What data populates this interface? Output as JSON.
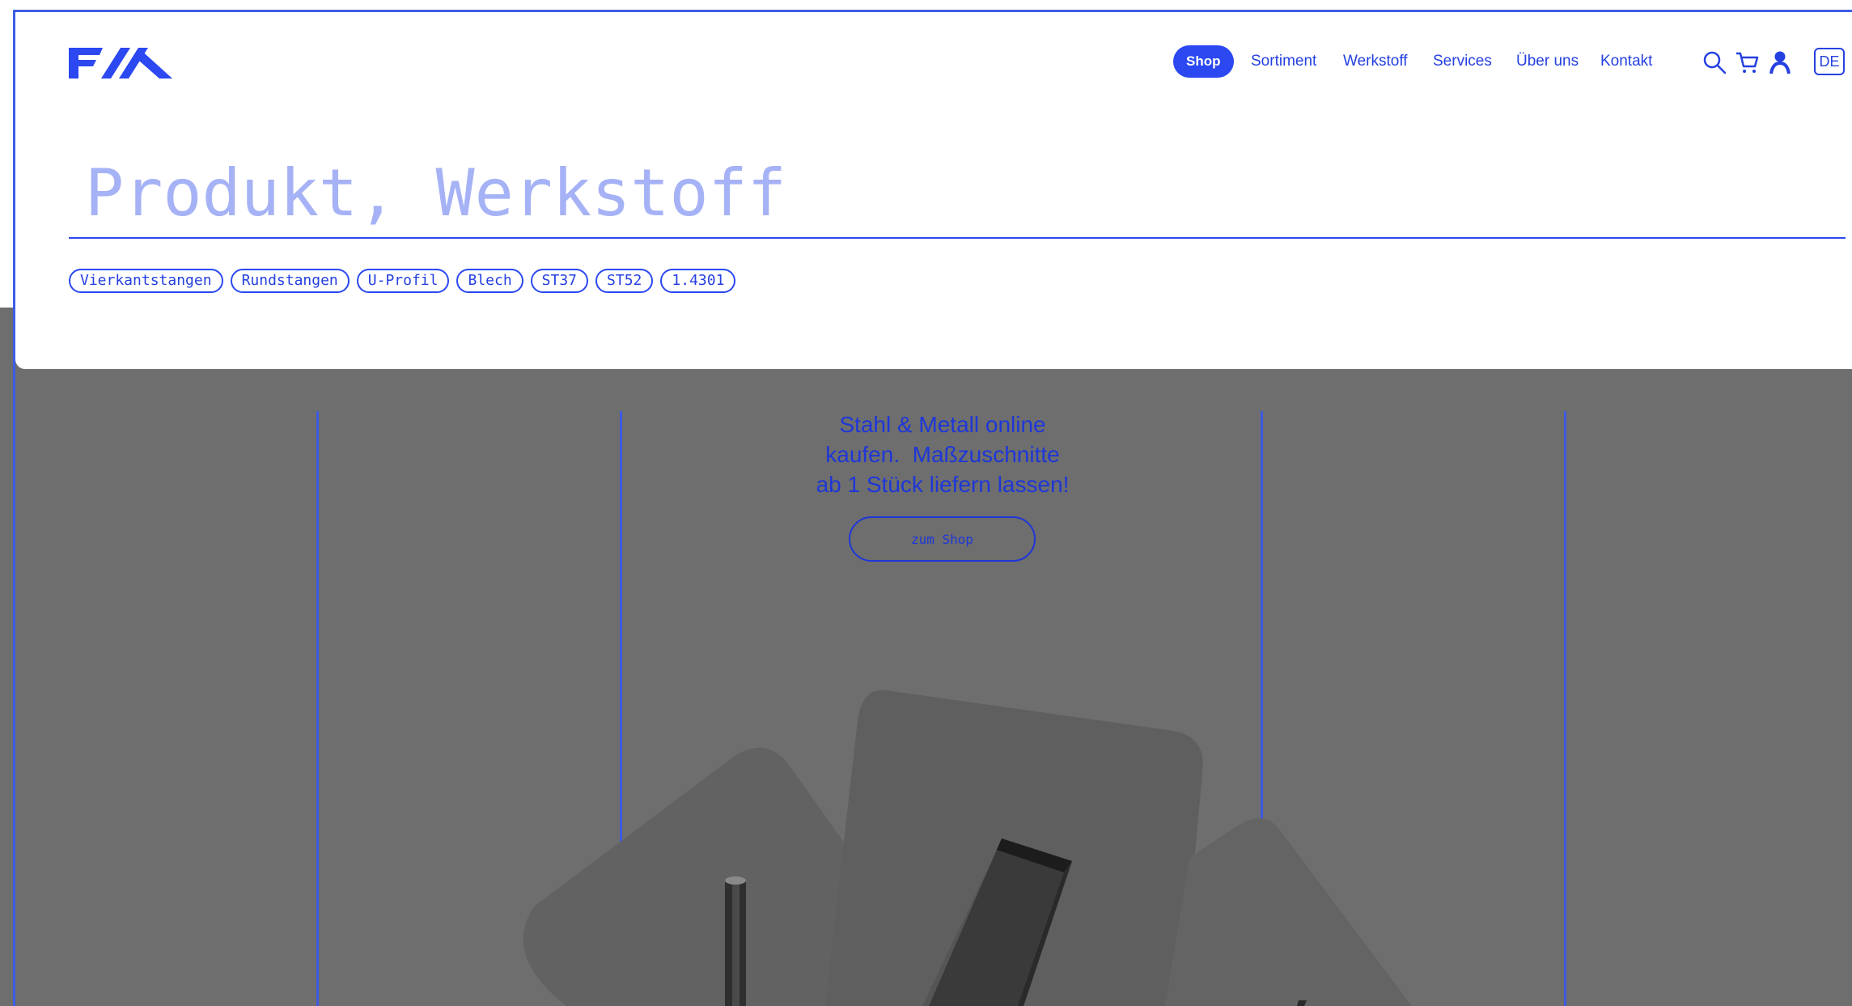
{
  "brand": {
    "logo_text": "F/X",
    "accent_color": "#2b48f1"
  },
  "nav": {
    "items": [
      {
        "label": "Shop",
        "active": true
      },
      {
        "label": "Sortiment",
        "active": false
      },
      {
        "label": "Werkstoff",
        "active": false
      },
      {
        "label": "Services",
        "active": false
      },
      {
        "label": "Über uns",
        "active": false
      },
      {
        "label": "Kontakt",
        "active": false
      }
    ],
    "icons": [
      "search-icon",
      "cart-icon",
      "user-icon"
    ],
    "language": "DE"
  },
  "search": {
    "placeholder": "Produkt, Werkstoff",
    "value": "",
    "chips": [
      "Vierkantstangen",
      "Rundstangen",
      "U-Profil",
      "Blech",
      "ST37",
      "ST52",
      "1.4301"
    ]
  },
  "hero": {
    "headline_lines": [
      "Stahl & Metall online",
      "kaufen.  Maßzuschnitte",
      "ab 1 Stück liefern lassen!"
    ],
    "cta_label": "zum Shop",
    "background_color": "#6e6e6e"
  }
}
